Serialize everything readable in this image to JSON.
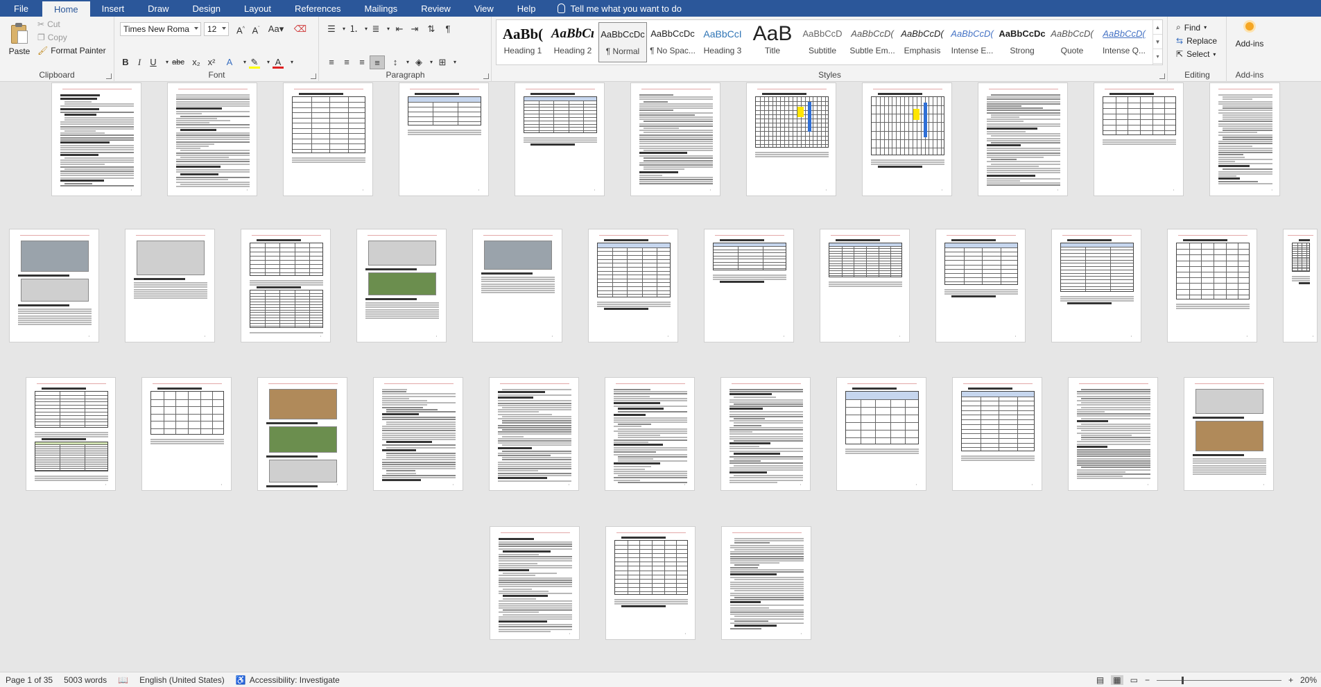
{
  "tabs": {
    "file": "File",
    "items": [
      "Home",
      "Insert",
      "Draw",
      "Design",
      "Layout",
      "References",
      "Mailings",
      "Review",
      "View",
      "Help"
    ],
    "active": "Home",
    "tell_me": "Tell me what you want to do"
  },
  "clipboard": {
    "paste": "Paste",
    "cut": "Cut",
    "copy": "Copy",
    "format_painter": "Format Painter",
    "label": "Clipboard"
  },
  "font": {
    "family": "Times New Roma",
    "size": "12",
    "label": "Font",
    "buttons": [
      "B",
      "I",
      "U",
      "abc",
      "x₂",
      "x²"
    ],
    "case_label": "Aa"
  },
  "paragraph": {
    "label": "Paragraph"
  },
  "styles": {
    "label": "Styles",
    "items": [
      {
        "sample": "AaBb(",
        "name": "Heading 1"
      },
      {
        "sample": "AaBbCı",
        "name": "Heading 2"
      },
      {
        "sample": "AaBbCcDc",
        "name": "¶ Normal"
      },
      {
        "sample": "AaBbCcDc",
        "name": "¶ No Spac..."
      },
      {
        "sample": "AaBbCcI",
        "name": "Heading 3"
      },
      {
        "sample": "AaB",
        "name": "Title"
      },
      {
        "sample": "AaBbCcD",
        "name": "Subtitle"
      },
      {
        "sample": "AaBbCcD(",
        "name": "Subtle Em..."
      },
      {
        "sample": "AaBbCcD(",
        "name": "Emphasis"
      },
      {
        "sample": "AaBbCcD(",
        "name": "Intense E..."
      },
      {
        "sample": "AaBbCcDc",
        "name": "Strong"
      },
      {
        "sample": "AaBbCcD(",
        "name": "Quote"
      },
      {
        "sample": "AaBbCcD(",
        "name": "Intense Q..."
      }
    ],
    "selected_index": 2
  },
  "editing": {
    "find": "Find",
    "replace": "Replace",
    "select": "Select",
    "label": "Editing"
  },
  "addins": {
    "button": "Add-ins",
    "label": "Add-ins"
  },
  "status": {
    "page": "Page 1 of 35",
    "words": "5003 words",
    "language": "English (United States)",
    "accessibility": "Accessibility: Investigate",
    "zoom": "20%"
  },
  "colors": {
    "brand": "#2b579a",
    "ribbon_bg": "#f3f3f3",
    "doc_bg": "#e6e6e6",
    "font_color": "#e02020",
    "highlight": "#ffff00"
  }
}
